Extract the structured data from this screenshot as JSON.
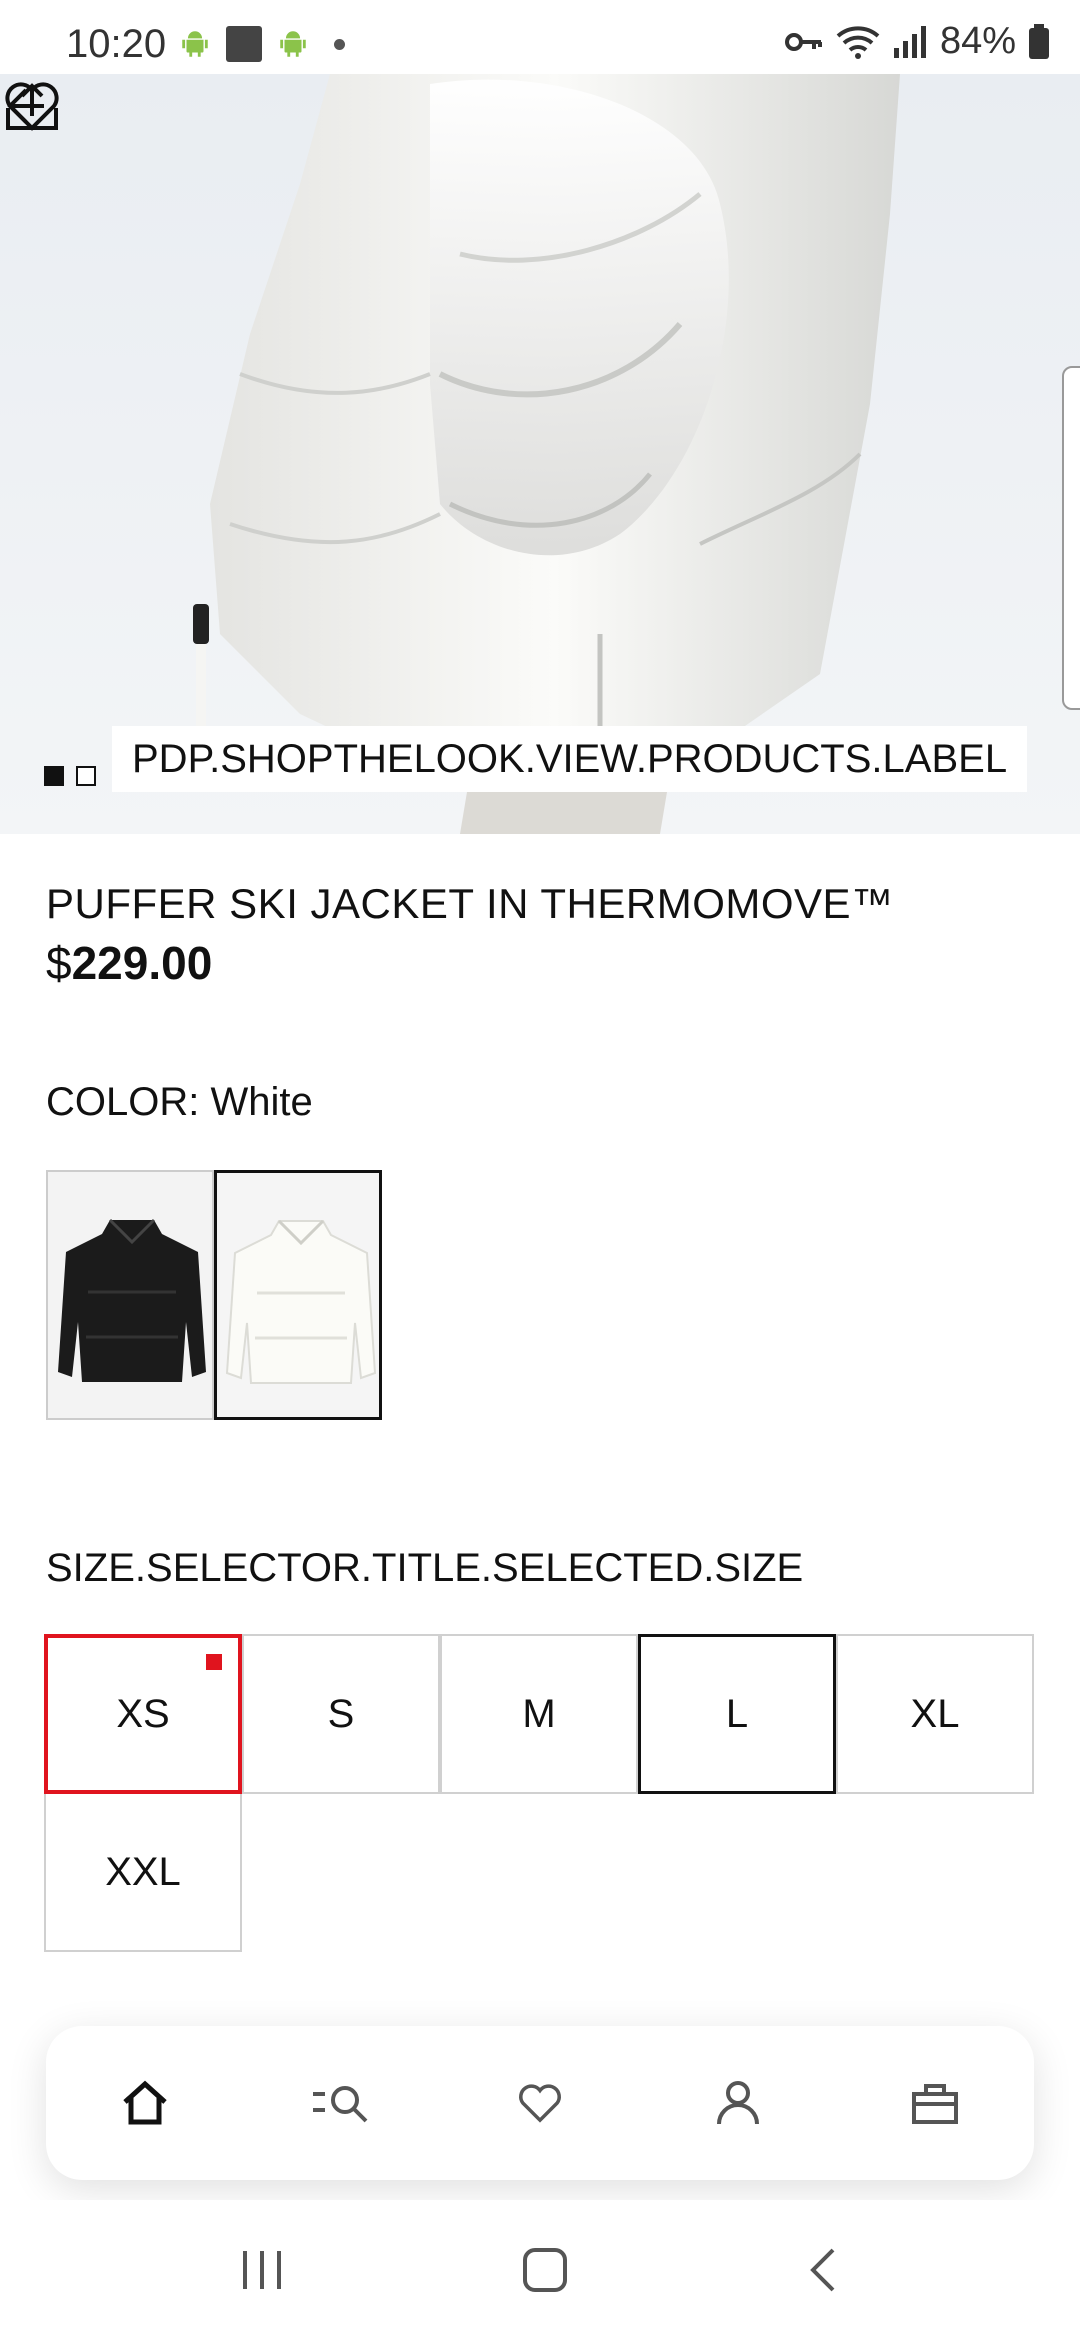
{
  "status_bar": {
    "time": "10:20",
    "battery": "84%",
    "icons": [
      "android-icon",
      "square-icon",
      "android-icon",
      "dot-icon",
      "vpn-key-icon",
      "wifi-icon",
      "signal-icon",
      "battery-icon"
    ]
  },
  "hero": {
    "shop_the_look_label": "PDP.SHOPTHELOOK.VIEW.PRODUCTS.LABEL",
    "image_count": 2,
    "active_image_index": 0
  },
  "product": {
    "name": "PUFFER SKI JACKET IN THERMOMOVE™",
    "currency": "$",
    "price": "229.00",
    "color_prefix": "COLOR:",
    "color_value": "White",
    "swatches": [
      {
        "color": "Black",
        "selected": false
      },
      {
        "color": "White",
        "selected": true
      }
    ]
  },
  "size_selector": {
    "title": "SIZE.SELECTOR.TITLE.SELECTED.SIZE",
    "sizes": [
      "XS",
      "S",
      "M",
      "L",
      "XL",
      "XXL"
    ],
    "selected": "L",
    "focused": "XS"
  },
  "bottom_nav": {
    "items": [
      "home-icon",
      "search-icon",
      "heart-icon",
      "account-icon",
      "bag-icon"
    ],
    "active": "home-icon"
  },
  "colors": {
    "focus_red": "#e0141e",
    "text": "#111111"
  }
}
